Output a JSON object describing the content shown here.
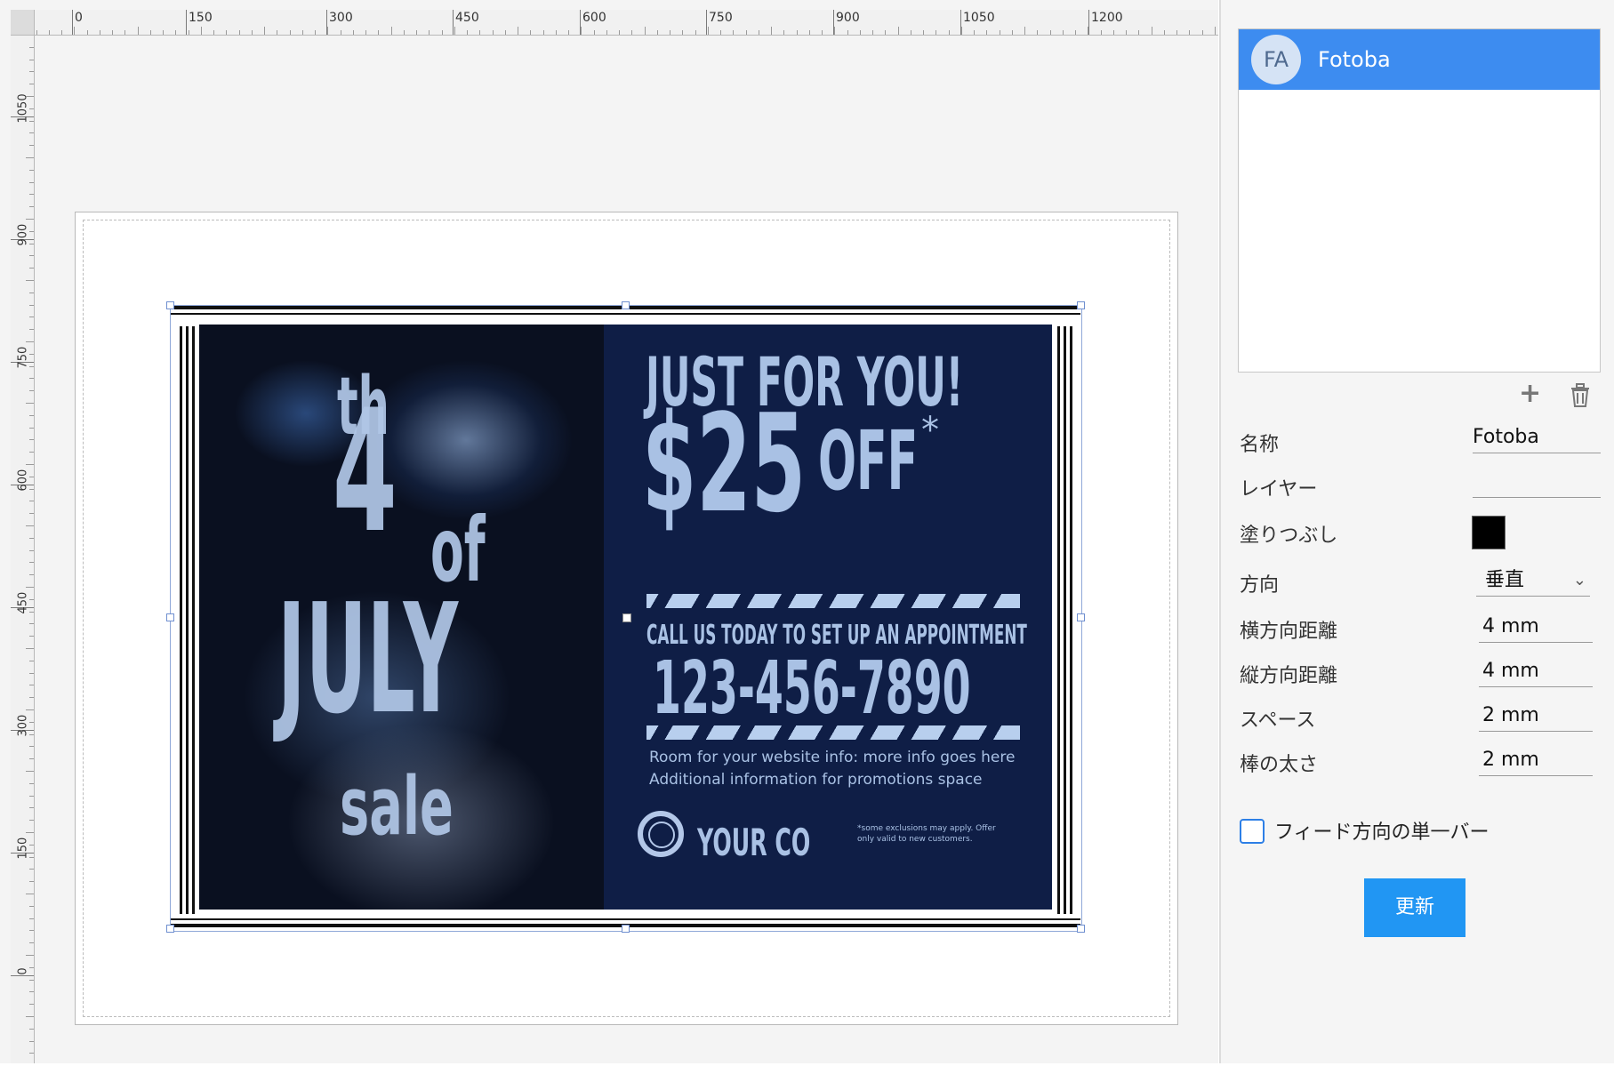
{
  "ruler": {
    "top_labels": [
      "0",
      "150",
      "300",
      "450",
      "600",
      "750",
      "900",
      "1050",
      "1200"
    ],
    "left_labels": [
      "1050",
      "900",
      "750",
      "600",
      "450",
      "300",
      "150",
      "0"
    ]
  },
  "design": {
    "left": {
      "number": "4",
      "suffix": "th",
      "of": "of",
      "month": "JULY",
      "word": "sale"
    },
    "right": {
      "headline": "JUST FOR YOU!",
      "amount": "$25",
      "off": "OFF",
      "asterisk": "*",
      "call": "CALL US TODAY TO SET UP AN APPOINTMENT",
      "phone": "123-456-7890",
      "info_line1": "Room for your website info:  more info goes here",
      "info_line2": "Additional information for promotions space",
      "logo_text": "YOUR CO",
      "disclaimer_line1": "*some exclusions may apply. Offer",
      "disclaimer_line2": "only valid to new customers."
    }
  },
  "panel": {
    "layers": [
      {
        "initials": "FA",
        "name": "Fotoba",
        "selected": true
      }
    ],
    "icons": {
      "add": "plus-icon",
      "delete": "trash-icon"
    },
    "props": {
      "name_label": "名称",
      "name_value": "Fotoba",
      "layer_label": "レイヤー",
      "layer_value": "",
      "fill_label": "塗りつぶし",
      "fill_color": "#000000",
      "direction_label": "方向",
      "direction_value": "垂直",
      "h_distance_label": "横方向距離",
      "h_distance_value": "4 mm",
      "v_distance_label": "縦方向距離",
      "v_distance_value": "4 mm",
      "space_label": "スペース",
      "space_value": "2 mm",
      "bar_thickness_label": "棒の太さ",
      "bar_thickness_value": "2 mm"
    },
    "checkbox_label": "フィード方向の単一バー",
    "checkbox_checked": false,
    "update_button": "更新"
  },
  "colors": {
    "selection": "#3d8cf0",
    "button": "#2196f3",
    "coupon_bg": "#0f1e46"
  }
}
